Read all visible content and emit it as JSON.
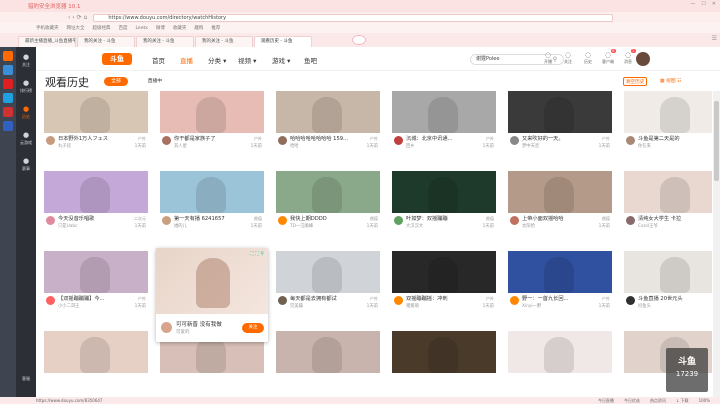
{
  "browser": {
    "title": "猎豹安全浏览器 10.1",
    "address": "https://www.douyu.com/directory/watchHistory",
    "bookmarks": [
      "手机收藏夹",
      "网址大全",
      "超级经典",
      "百度",
      "Leetx",
      "微博",
      "收藏夹",
      "趣购",
      "推荐"
    ],
    "tabs": [
      "最新主播直播_斗鱼直播平台",
      "我的关注 - 斗鱼",
      "我的关注 - 斗鱼",
      "我的关注 - 斗鱼",
      "观看历史 - 斗鱼"
    ],
    "extensions": "扩展",
    "downloads": "下载",
    "status_url": "https://www.douyu.com/8350647",
    "status_items": [
      "今日直播",
      "今日优选",
      "热点资讯",
      "↓ 下载",
      "100%"
    ]
  },
  "colors": {
    "accent": "#ff6a00",
    "sidebar": "#2c2f35",
    "tab_bg": "#fbe9e9"
  },
  "nav": [
    {
      "icon": "heart-icon",
      "label": "关注",
      "on": false
    },
    {
      "icon": "hot-icon",
      "label": "排行榜",
      "on": false
    },
    {
      "icon": "clock-icon",
      "label": "历史",
      "on": true
    },
    {
      "icon": "game-icon",
      "label": "云游戏",
      "on": false
    },
    {
      "icon": "trophy-icon",
      "label": "赛事",
      "on": false
    }
  ],
  "nav_bottom": "客服",
  "header": {
    "logo": "斗鱼",
    "menu": [
      "首页",
      "直播",
      "分类 ▾",
      "视频 ▾",
      "游戏 ▾",
      "鱼吧"
    ],
    "search_value": "谢霆Polee",
    "tools": [
      {
        "l": "开播",
        "b": ""
      },
      {
        "l": "关注",
        "b": ""
      },
      {
        "l": "历史",
        "b": ""
      },
      {
        "l": "客户端",
        "b": "8"
      },
      {
        "l": "消息",
        "b": "2"
      }
    ]
  },
  "content": {
    "title": "观看历史",
    "filter_all": "全部",
    "filter_live": "直播中",
    "clear": "清空历史",
    "view_switch": "▦ 视图 ☷"
  },
  "hover_card": {
    "title": "可可新晋 没有我做",
    "streamer": "可爱的",
    "follow": "关注",
    "tools": "⛶ ⛶ ⚲"
  },
  "cards": [
    {
      "t": "日本野外1万人フェス",
      "s": "丸子叔",
      "c": "户外",
      "h": "1天前",
      "bg": "#d8c6b4",
      "av": "#c89a80"
    },
    {
      "t": "你干都是家族子了",
      "s": "其人星",
      "c": "户外",
      "h": "1天前",
      "bg": "#e6bcb4",
      "av": "#a87060"
    },
    {
      "t": "哈哈哈哈哈哈哈哈 159...",
      "s": "哈哈",
      "c": "户外",
      "h": "1天前",
      "bg": "#c7b7a8",
      "av": "#906e5a"
    },
    {
      "t": "沉城：北京中讯通...",
      "s": "回乡",
      "c": "户外",
      "h": "1天前",
      "bg": "#a8a8a8",
      "av": "#c04040"
    },
    {
      "t": "又来吹好的一天。",
      "s": "梦中天音",
      "c": "户外",
      "h": "1天前",
      "bg": "#3a3a3a",
      "av": "#888"
    },
    {
      "t": "斗鱼是第二天是的",
      "s": "你在来",
      "c": "户外",
      "h": "1天前",
      "bg": "#f0ebe6",
      "av": "#aa8877"
    },
    {
      "t": "今天没音乐唱歌",
      "s": "只是Uabc",
      "c": "二次元",
      "h": "1天前",
      "bg": "#c4a8d8",
      "av": "#e08aa0"
    },
    {
      "t": "第一天有播 6241657",
      "s": "她的儿",
      "c": "颜值",
      "h": "1天前",
      "bg": "#9cc4d8",
      "av": "#c8a080"
    },
    {
      "t": "我快上期DDDD",
      "s": "TD一汪顺峰",
      "c": "颜值",
      "h": "1天前",
      "bg": "#8aa88a",
      "av": "#ff8800"
    },
    {
      "t": "叶如梦：双摇蹦蹦",
      "s": "大汉汉大",
      "c": "颜值",
      "h": "1天前",
      "bg": "#1e3a2a",
      "av": "#60a060"
    },
    {
      "t": "上帝小面双摇哈哈",
      "s": "太阳哈",
      "c": "颜值",
      "h": "1天前",
      "bg": "#b49a88",
      "av": "#c07060"
    },
    {
      "t": "清纯女大学生 卡拉",
      "s": "Carol王爷",
      "c": "颜值",
      "h": "1天前",
      "bg": "#e8d8d0",
      "av": "#8a6a6a"
    },
    {
      "t": "【双摇蹦蹦蹦】今...",
      "s": "小小二哥王",
      "c": "户外",
      "h": "1天前",
      "bg": "#c8b0c8",
      "av": "#ff6060"
    },
    {
      "t": "",
      "s": "",
      "c": "",
      "h": "",
      "bg": "#e8d4c8",
      "av": "#d9a48c"
    },
    {
      "t": "每天都是去拥有都试",
      "s": "完美蹦",
      "c": "户外",
      "h": "1天前",
      "bg": "#d0d4d8",
      "av": "#706050"
    },
    {
      "t": "双摇蹦蹦摇：冲刺",
      "s": "猪猪萌",
      "c": "户外",
      "h": "1天前",
      "bg": "#282828",
      "av": "#ff8800"
    },
    {
      "t": "野一：一首九长回...",
      "s": "Xinyi一野",
      "c": "户外",
      "h": "1天前",
      "bg": "#3050a0",
      "av": "#ff8800"
    },
    {
      "t": "斗鱼直播 20世元头",
      "s": "抖鱼头",
      "c": "户外",
      "h": "1天前",
      "bg": "#e8e4e0",
      "av": "#303030"
    },
    {
      "t": "",
      "s": "",
      "c": "",
      "h": "",
      "bg": "#e6cfc4",
      "av": "#ccc"
    },
    {
      "t": "",
      "s": "",
      "c": "",
      "h": "",
      "bg": "#d8c0b8",
      "av": "#ccc"
    },
    {
      "t": "",
      "s": "",
      "c": "",
      "h": "",
      "bg": "#c8b4ac",
      "av": "#ccc"
    },
    {
      "t": "",
      "s": "",
      "c": "",
      "h": "",
      "bg": "#4a3a2a",
      "av": "#ccc"
    },
    {
      "t": "",
      "s": "",
      "c": "",
      "h": "",
      "bg": "#f0e8e6",
      "av": "#ccc"
    },
    {
      "t": "",
      "s": "",
      "c": "",
      "h": "",
      "bg": "#e2d2cc",
      "av": "#ccc"
    }
  ],
  "watermark": {
    "brand": "斗鱼",
    "room": "17239"
  }
}
